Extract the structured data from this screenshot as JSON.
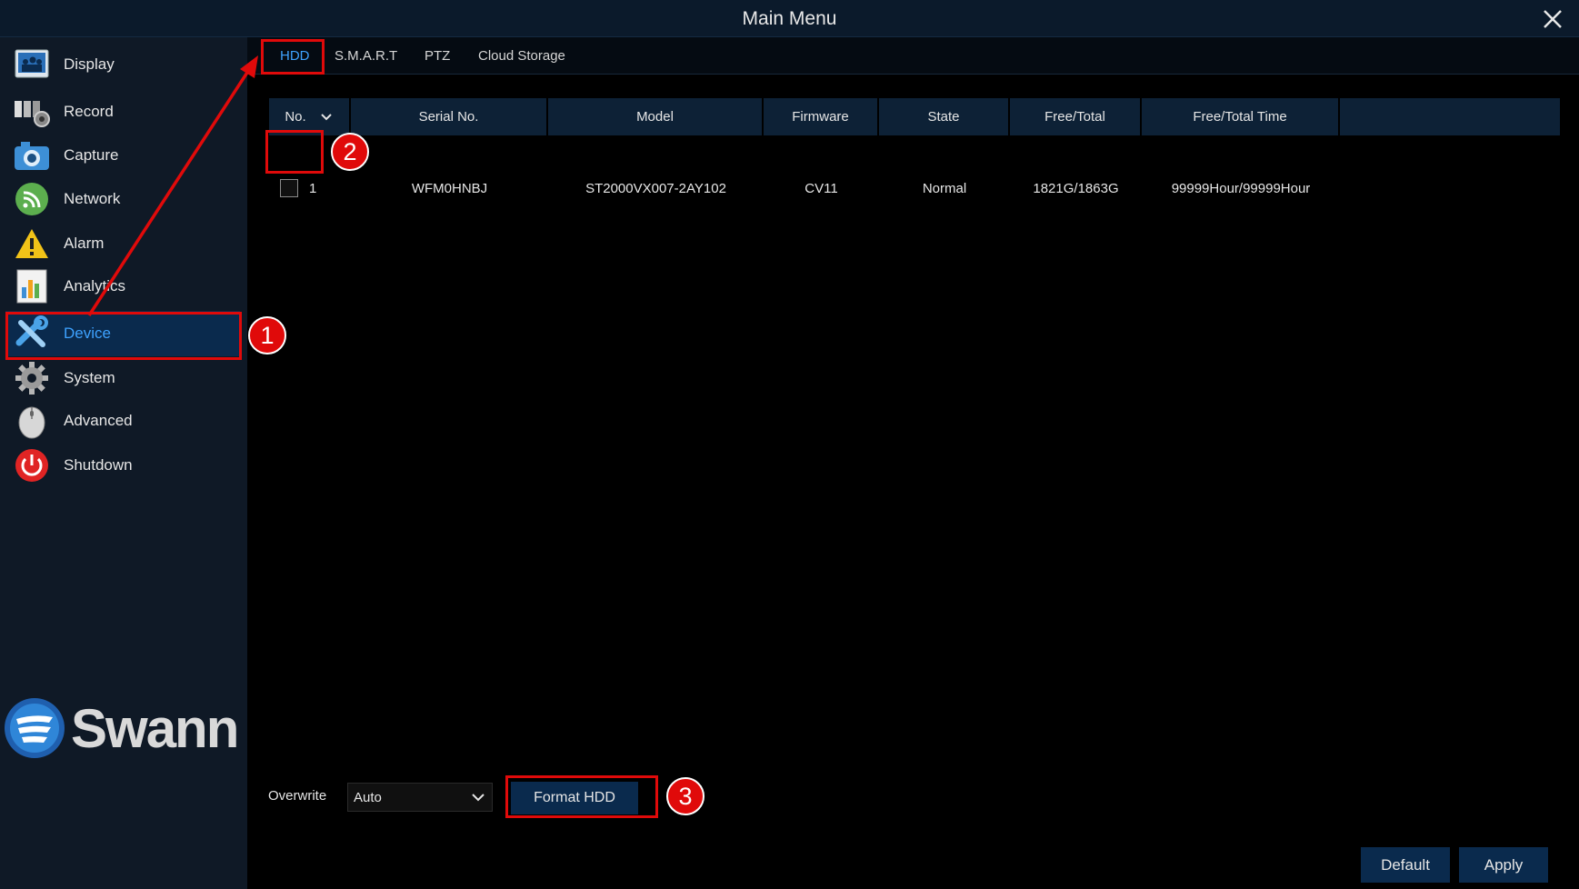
{
  "window": {
    "title": "Main Menu"
  },
  "sidebar": {
    "items": [
      {
        "label": "Display",
        "icon": "display-icon"
      },
      {
        "label": "Record",
        "icon": "record-icon"
      },
      {
        "label": "Capture",
        "icon": "camera-icon"
      },
      {
        "label": "Network",
        "icon": "network-icon"
      },
      {
        "label": "Alarm",
        "icon": "alarm-warning-icon"
      },
      {
        "label": "Analytics",
        "icon": "analytics-chart-icon"
      },
      {
        "label": "Device",
        "icon": "tools-icon",
        "active": true
      },
      {
        "label": "System",
        "icon": "gear-icon"
      },
      {
        "label": "Advanced",
        "icon": "mouse-icon"
      },
      {
        "label": "Shutdown",
        "icon": "power-icon"
      }
    ],
    "logo": "Swann"
  },
  "tabs": [
    {
      "label": "HDD",
      "active": true
    },
    {
      "label": "S.M.A.R.T"
    },
    {
      "label": "PTZ"
    },
    {
      "label": "Cloud Storage"
    }
  ],
  "table": {
    "columns": [
      "No.",
      "Serial No.",
      "Model",
      "Firmware",
      "State",
      "Free/Total",
      "Free/Total Time"
    ],
    "rows": [
      {
        "no": "1",
        "serial": "WFM0HNBJ",
        "model": "ST2000VX007-2AY102",
        "firmware": "CV11",
        "state": "Normal",
        "free_total": "1821G/1863G",
        "free_total_time": "99999Hour/99999Hour"
      }
    ]
  },
  "controls": {
    "overwrite_label": "Overwrite",
    "overwrite_value": "Auto",
    "format_button": "Format HDD",
    "default_button": "Default",
    "apply_button": "Apply"
  },
  "annotations": {
    "step1": "1",
    "step2": "2",
    "step3": "3",
    "color": "#e00a0a"
  },
  "colors": {
    "accent": "#3ea2ff",
    "active_bg": "#0a2a4d",
    "title_bg": "#0b1a2b"
  }
}
